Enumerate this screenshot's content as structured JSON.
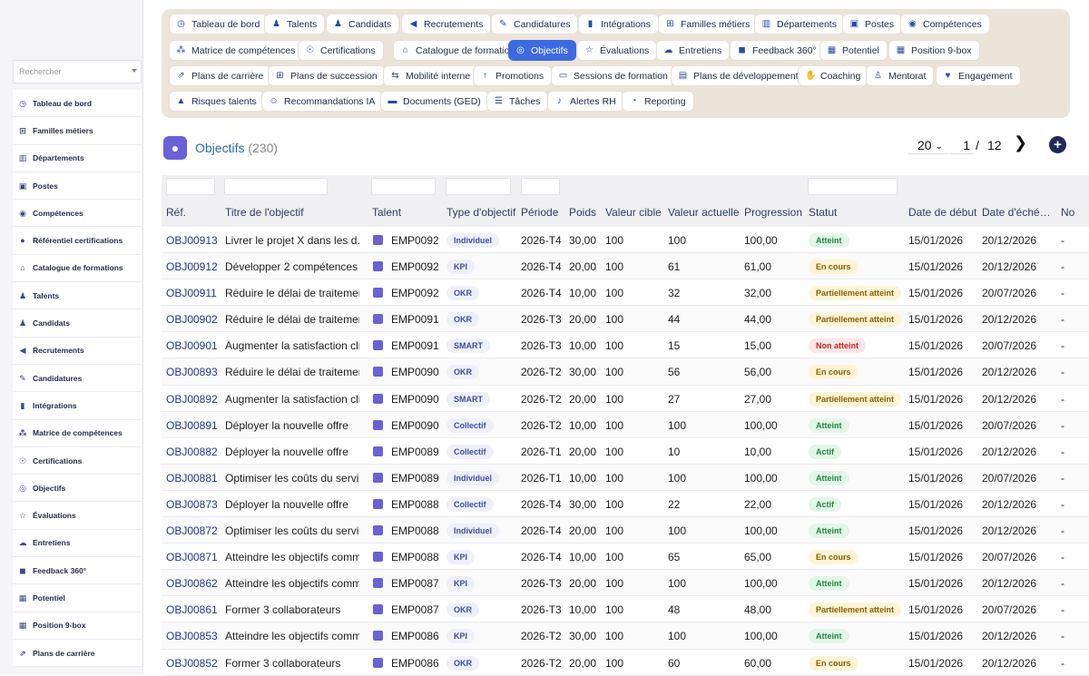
{
  "sidebar": {
    "search_placeholder": "Rechercher",
    "items": [
      {
        "label": "Tableau de bord",
        "icon": "dashboard-icon"
      },
      {
        "label": "Familles métiers",
        "icon": "org-chart-icon"
      },
      {
        "label": "Départements",
        "icon": "building-icon"
      },
      {
        "label": "Postes",
        "icon": "badge-icon"
      },
      {
        "label": "Compétences",
        "icon": "brain-icon"
      },
      {
        "label": "Référentiel certifications",
        "icon": "certificate-icon"
      },
      {
        "label": "Catalogue de formations",
        "icon": "graduation-icon"
      },
      {
        "label": "Talents",
        "icon": "user-icon"
      },
      {
        "label": "Candidats",
        "icon": "user-plus-icon"
      },
      {
        "label": "Recrutements",
        "icon": "megaphone-icon"
      },
      {
        "label": "Candidatures",
        "icon": "file-edit-icon"
      },
      {
        "label": "Intégrations",
        "icon": "door-icon"
      },
      {
        "label": "Matrice de compétences",
        "icon": "matrix-icon"
      },
      {
        "label": "Certifications",
        "icon": "award-icon"
      },
      {
        "label": "Objectifs",
        "icon": "target-icon"
      },
      {
        "label": "Évaluations",
        "icon": "star-icon"
      },
      {
        "label": "Entretiens",
        "icon": "chat-icon"
      },
      {
        "label": "Feedback 360°",
        "icon": "comment-icon"
      },
      {
        "label": "Potentiel",
        "icon": "chart-icon"
      },
      {
        "label": "Position 9-box",
        "icon": "grid-icon"
      },
      {
        "label": "Plans de carrière",
        "icon": "career-icon"
      }
    ]
  },
  "nav": {
    "rows": [
      [
        {
          "label": "Tableau de bord",
          "icon": "dashboard-icon"
        },
        {
          "label": "Talents",
          "icon": "user-icon"
        },
        {
          "label": "Candidats",
          "icon": "user-plus-icon"
        },
        {
          "label": "Recrutements",
          "icon": "megaphone-icon"
        },
        {
          "label": "Candidatures",
          "icon": "file-edit-icon"
        },
        {
          "label": "Intégrations",
          "icon": "door-icon"
        },
        {
          "label": "Familles métiers",
          "icon": "org-chart-icon"
        },
        {
          "label": "Départements",
          "icon": "building-icon"
        },
        {
          "label": "Postes",
          "icon": "badge-icon"
        },
        {
          "label": "Compétences",
          "icon": "brain-icon"
        }
      ],
      [
        {
          "label": "Matrice de compétences",
          "icon": "matrix-icon"
        },
        {
          "label": "Certifications",
          "icon": "award-icon"
        },
        {
          "label": "Catalogue de formations",
          "icon": "graduation-icon"
        },
        {
          "label": "Objectifs",
          "icon": "target-icon",
          "active": true
        },
        {
          "label": "Évaluations",
          "icon": "star-icon"
        },
        {
          "label": "Entretiens",
          "icon": "chat-icon"
        },
        {
          "label": "Feedback 360°",
          "icon": "comment-icon"
        },
        {
          "label": "Potentiel",
          "icon": "chart-icon"
        },
        {
          "label": "Position 9-box",
          "icon": "grid-icon"
        }
      ],
      [
        {
          "label": "Plans de carrière",
          "icon": "career-icon"
        },
        {
          "label": "Plans de succession",
          "icon": "org-chart-icon"
        },
        {
          "label": "Mobilité interne",
          "icon": "swap-icon"
        },
        {
          "label": "Promotions",
          "icon": "arrow-up-icon"
        },
        {
          "label": "Sessions de formation",
          "icon": "presentation-icon"
        },
        {
          "label": "Plans de développement",
          "icon": "clipboard-icon"
        },
        {
          "label": "Coaching",
          "icon": "handshake-icon"
        },
        {
          "label": "Mentorat",
          "icon": "mentor-icon"
        },
        {
          "label": "Engagement",
          "icon": "heart-icon"
        }
      ],
      [
        {
          "label": "Risques talents",
          "icon": "warning-icon"
        },
        {
          "label": "Recommandations IA",
          "icon": "robot-icon"
        },
        {
          "label": "Documents (GED)",
          "icon": "folder-icon"
        },
        {
          "label": "Tâches",
          "icon": "list-icon"
        },
        {
          "label": "Alertes RH",
          "icon": "bell-icon"
        },
        {
          "label": "Reporting",
          "icon": "pie-icon"
        }
      ]
    ]
  },
  "page": {
    "title": "Objectifs",
    "count": "(230)",
    "page_size": "20",
    "current_page": "1",
    "page_sep": "/",
    "total_pages": "12"
  },
  "table": {
    "columns": [
      "Réf.",
      "Titre de l'objectif",
      "Talent",
      "Type d'objectif",
      "Période",
      "Poids",
      "Valeur cible",
      "Valeur actuelle",
      "Progression",
      "Statut",
      "Date de début",
      "Date d'éché…",
      "No"
    ],
    "rows": [
      {
        "ref": "OBJ00913",
        "title": "Livrer le projet X dans les d…",
        "talent": "EMP0092",
        "type": "Individuel",
        "period": "2026-T4",
        "weight": "30,00",
        "target": "100",
        "current": "100",
        "progress": "100,00",
        "status": "Atteint",
        "status_kind": "s-atteint",
        "start": "15/01/2026",
        "due": "20/12/2026",
        "note": "-"
      },
      {
        "ref": "OBJ00912",
        "title": "Développer 2 compétences …",
        "talent": "EMP0092",
        "type": "KPI",
        "period": "2026-T4",
        "weight": "20,00",
        "target": "100",
        "current": "61",
        "progress": "61,00",
        "status": "En cours",
        "status_kind": "s-encours",
        "start": "15/01/2026",
        "due": "20/12/2026",
        "note": "-"
      },
      {
        "ref": "OBJ00911",
        "title": "Réduire le délai de traitement",
        "talent": "EMP0092",
        "type": "OKR",
        "period": "2026-T4",
        "weight": "10,00",
        "target": "100",
        "current": "32",
        "progress": "32,00",
        "status": "Partiellement atteint",
        "status_kind": "s-partiel",
        "start": "15/01/2026",
        "due": "20/07/2026",
        "note": "-"
      },
      {
        "ref": "OBJ00902",
        "title": "Réduire le délai de traitement",
        "talent": "EMP0091",
        "type": "OKR",
        "period": "2026-T3",
        "weight": "20,00",
        "target": "100",
        "current": "44",
        "progress": "44,00",
        "status": "Partiellement atteint",
        "status_kind": "s-partiel",
        "start": "15/01/2026",
        "due": "20/12/2026",
        "note": "-"
      },
      {
        "ref": "OBJ00901",
        "title": "Augmenter la satisfaction cli…",
        "talent": "EMP0091",
        "type": "SMART",
        "period": "2026-T3",
        "weight": "10,00",
        "target": "100",
        "current": "15",
        "progress": "15,00",
        "status": "Non atteint",
        "status_kind": "s-non",
        "start": "15/01/2026",
        "due": "20/07/2026",
        "note": "-"
      },
      {
        "ref": "OBJ00893",
        "title": "Réduire le délai de traitement",
        "talent": "EMP0090",
        "type": "OKR",
        "period": "2026-T2",
        "weight": "30,00",
        "target": "100",
        "current": "56",
        "progress": "56,00",
        "status": "En cours",
        "status_kind": "s-encours",
        "start": "15/01/2026",
        "due": "20/12/2026",
        "note": "-"
      },
      {
        "ref": "OBJ00892",
        "title": "Augmenter la satisfaction cli…",
        "talent": "EMP0090",
        "type": "SMART",
        "period": "2026-T2",
        "weight": "20,00",
        "target": "100",
        "current": "27",
        "progress": "27,00",
        "status": "Partiellement atteint",
        "status_kind": "s-partiel",
        "start": "15/01/2026",
        "due": "20/12/2026",
        "note": "-"
      },
      {
        "ref": "OBJ00891",
        "title": "Déployer la nouvelle offre",
        "talent": "EMP0090",
        "type": "Collectif",
        "period": "2026-T2",
        "weight": "10,00",
        "target": "100",
        "current": "100",
        "progress": "100,00",
        "status": "Atteint",
        "status_kind": "s-atteint",
        "start": "15/01/2026",
        "due": "20/07/2026",
        "note": "-"
      },
      {
        "ref": "OBJ00882",
        "title": "Déployer la nouvelle offre",
        "talent": "EMP0089",
        "type": "Collectif",
        "period": "2026-T1",
        "weight": "20,00",
        "target": "100",
        "current": "10",
        "progress": "10,00",
        "status": "Actif",
        "status_kind": "s-actif",
        "start": "15/01/2026",
        "due": "20/12/2026",
        "note": "-"
      },
      {
        "ref": "OBJ00881",
        "title": "Optimiser les coûts du service",
        "talent": "EMP0089",
        "type": "Individuel",
        "period": "2026-T1",
        "weight": "10,00",
        "target": "100",
        "current": "100",
        "progress": "100,00",
        "status": "Atteint",
        "status_kind": "s-atteint",
        "start": "15/01/2026",
        "due": "20/07/2026",
        "note": "-"
      },
      {
        "ref": "OBJ00873",
        "title": "Déployer la nouvelle offre",
        "talent": "EMP0088",
        "type": "Collectif",
        "period": "2026-T4",
        "weight": "30,00",
        "target": "100",
        "current": "22",
        "progress": "22,00",
        "status": "Actif",
        "status_kind": "s-actif",
        "start": "15/01/2026",
        "due": "20/12/2026",
        "note": "-"
      },
      {
        "ref": "OBJ00872",
        "title": "Optimiser les coûts du service",
        "talent": "EMP0088",
        "type": "Individuel",
        "period": "2026-T4",
        "weight": "20,00",
        "target": "100",
        "current": "100",
        "progress": "100,00",
        "status": "Atteint",
        "status_kind": "s-atteint",
        "start": "15/01/2026",
        "due": "20/12/2026",
        "note": "-"
      },
      {
        "ref": "OBJ00871",
        "title": "Atteindre les objectifs comm…",
        "talent": "EMP0088",
        "type": "KPI",
        "period": "2026-T4",
        "weight": "10,00",
        "target": "100",
        "current": "65",
        "progress": "65,00",
        "status": "En cours",
        "status_kind": "s-encours",
        "start": "15/01/2026",
        "due": "20/07/2026",
        "note": "-"
      },
      {
        "ref": "OBJ00862",
        "title": "Atteindre les objectifs comm…",
        "talent": "EMP0087",
        "type": "KPI",
        "period": "2026-T3",
        "weight": "20,00",
        "target": "100",
        "current": "100",
        "progress": "100,00",
        "status": "Atteint",
        "status_kind": "s-atteint",
        "start": "15/01/2026",
        "due": "20/12/2026",
        "note": "-"
      },
      {
        "ref": "OBJ00861",
        "title": "Former 3 collaborateurs",
        "talent": "EMP0087",
        "type": "OKR",
        "period": "2026-T3",
        "weight": "10,00",
        "target": "100",
        "current": "48",
        "progress": "48,00",
        "status": "Partiellement atteint",
        "status_kind": "s-partiel",
        "start": "15/01/2026",
        "due": "20/07/2026",
        "note": "-"
      },
      {
        "ref": "OBJ00853",
        "title": "Atteindre les objectifs comm…",
        "talent": "EMP0086",
        "type": "KPI",
        "period": "2026-T2",
        "weight": "30,00",
        "target": "100",
        "current": "100",
        "progress": "100,00",
        "status": "Atteint",
        "status_kind": "s-atteint",
        "start": "15/01/2026",
        "due": "20/12/2026",
        "note": "-"
      },
      {
        "ref": "OBJ00852",
        "title": "Former 3 collaborateurs",
        "talent": "EMP0086",
        "type": "OKR",
        "period": "2026-T2",
        "weight": "20,00",
        "target": "100",
        "current": "60",
        "progress": "60,00",
        "status": "En cours",
        "status_kind": "s-encours",
        "start": "15/01/2026",
        "due": "20/12/2026",
        "note": "-"
      }
    ]
  }
}
